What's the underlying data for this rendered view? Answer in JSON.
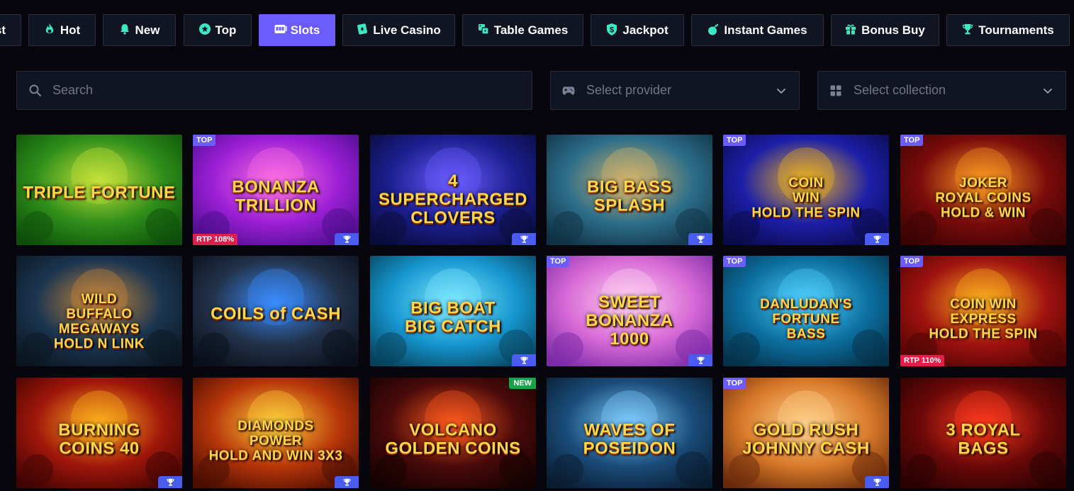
{
  "tabs": [
    {
      "label": "st",
      "icon": "star-icon",
      "active": false
    },
    {
      "label": "Hot",
      "icon": "flame-icon",
      "active": false
    },
    {
      "label": "New",
      "icon": "bell-icon",
      "active": false
    },
    {
      "label": "Top",
      "icon": "star-circle-icon",
      "active": false
    },
    {
      "label": "Slots",
      "icon": "slot-machine-icon",
      "active": true
    },
    {
      "label": "Live Casino",
      "icon": "playing-card-icon",
      "active": false
    },
    {
      "label": "Table Games",
      "icon": "dice-icon",
      "active": false
    },
    {
      "label": "Jackpot",
      "icon": "dollar-shield-icon",
      "active": false
    },
    {
      "label": "Instant Games",
      "icon": "bomb-icon",
      "active": false
    },
    {
      "label": "Bonus Buy",
      "icon": "gift-icon",
      "active": false
    },
    {
      "label": "Tournaments",
      "icon": "trophy-icon",
      "active": false
    }
  ],
  "filters": {
    "search_placeholder": "Search",
    "provider_placeholder": "Select provider",
    "collection_placeholder": "Select collection"
  },
  "colors": {
    "accent": "#6c5cff",
    "tab_icon": "#3ce7c3",
    "rtp_badge": "#e11d48",
    "new_badge": "#1aa24a",
    "trophy_badge": "#4a5cf0",
    "background": "#06060c"
  },
  "games": [
    {
      "title": "TRIPLE FORTUNE",
      "top": "",
      "rtp": "",
      "new": "",
      "trophy": false
    },
    {
      "title": "BONANZA\nTRILLION",
      "top": "TOP",
      "rtp": "RTP 108%",
      "new": "",
      "trophy": true
    },
    {
      "title": "4 SUPERCHARGED\nCLOVERS",
      "top": "",
      "rtp": "",
      "new": "",
      "trophy": true
    },
    {
      "title": "BIG BASS\nSPLASH",
      "top": "",
      "rtp": "",
      "new": "",
      "trophy": true
    },
    {
      "title": "COIN\nWIN\nHOLD THE SPIN",
      "top": "TOP",
      "rtp": "",
      "new": "",
      "trophy": true
    },
    {
      "title": "JOKER\nROYAL COINS\nHOLD & WIN",
      "top": "TOP",
      "rtp": "",
      "new": "",
      "trophy": false
    },
    {
      "title": "WILD\nBUFFALO\nMEGAWAYS\nHOLD N LINK",
      "top": "",
      "rtp": "",
      "new": "",
      "trophy": false
    },
    {
      "title": "COILS of CASH",
      "top": "",
      "rtp": "",
      "new": "",
      "trophy": false
    },
    {
      "title": "BIG BOAT\nBIG CATCH",
      "top": "",
      "rtp": "",
      "new": "",
      "trophy": true
    },
    {
      "title": "SWEET BONANZA\n1000",
      "top": "TOP",
      "rtp": "",
      "new": "",
      "trophy": true
    },
    {
      "title": "DANLUDAN'S\nFORTUNE\nBASS",
      "top": "TOP",
      "rtp": "",
      "new": "",
      "trophy": false
    },
    {
      "title": "COIN WIN\nEXPRESS\nHOLD THE SPIN",
      "top": "TOP",
      "rtp": "RTP 110%",
      "new": "",
      "trophy": false
    },
    {
      "title": "BURNING\nCOINS 40",
      "top": "",
      "rtp": "",
      "new": "",
      "trophy": true
    },
    {
      "title": "DIAMONDS\nPOWER\nHOLD AND WIN 3X3",
      "top": "",
      "rtp": "",
      "new": "",
      "trophy": true
    },
    {
      "title": "VOLCANO\nGOLDEN COINS",
      "top": "",
      "rtp": "",
      "new": "NEW",
      "trophy": false
    },
    {
      "title": "WAVES OF\nPOSEIDON",
      "top": "",
      "rtp": "",
      "new": "",
      "trophy": false
    },
    {
      "title": "GOLD RUSH\nJOHNNY CASH",
      "top": "TOP",
      "rtp": "",
      "new": "",
      "trophy": true
    },
    {
      "title": "3 ROYAL\nBAGS",
      "top": "",
      "rtp": "",
      "new": "",
      "trophy": false
    }
  ]
}
